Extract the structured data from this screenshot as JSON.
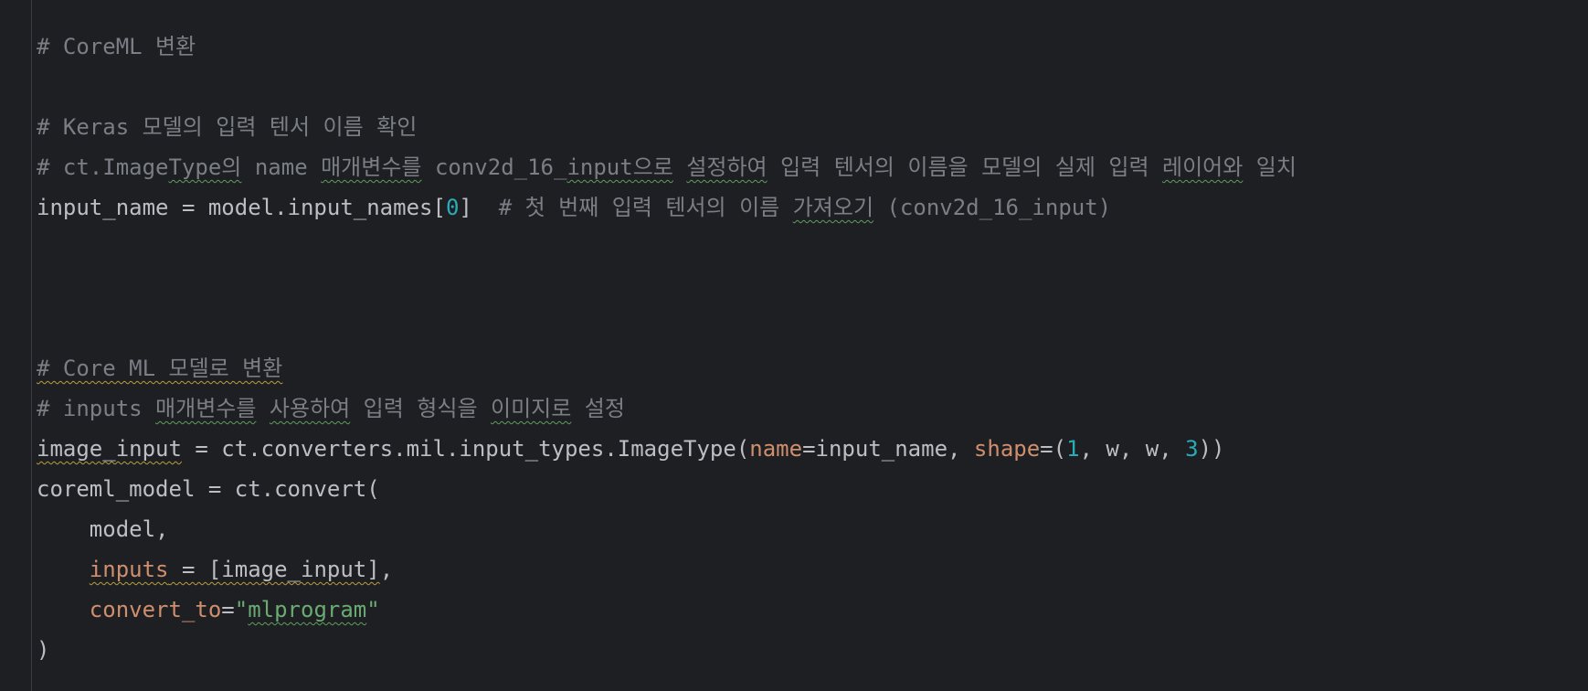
{
  "editor": {
    "lines": [
      [
        {
          "t": "# CoreML 변환",
          "c": "cm"
        }
      ],
      [],
      [
        {
          "t": "# Keras 모델의 입력 텐서 이름 확인",
          "c": "cm"
        }
      ],
      [
        {
          "t": "# ct.Image",
          "c": "cm"
        },
        {
          "t": "Type의",
          "c": "cm",
          "u": "g"
        },
        {
          "t": " name ",
          "c": "cm"
        },
        {
          "t": "매개변수를",
          "c": "cm",
          "u": "g"
        },
        {
          "t": " conv2d_16_",
          "c": "cm"
        },
        {
          "t": "input으로",
          "c": "cm",
          "u": "g"
        },
        {
          "t": " ",
          "c": "cm"
        },
        {
          "t": "설정하여",
          "c": "cm",
          "u": "g"
        },
        {
          "t": " 입력 텐서의 이름을 모델의 실제 입력 ",
          "c": "cm"
        },
        {
          "t": "레이어와",
          "c": "cm",
          "u": "g"
        },
        {
          "t": " 일치",
          "c": "cm"
        }
      ],
      [
        {
          "t": "input_name = model.input_names[",
          "c": "txt"
        },
        {
          "t": "0",
          "c": "num"
        },
        {
          "t": "]  ",
          "c": "txt"
        },
        {
          "t": "# 첫 번째 입력 텐서의 이름 ",
          "c": "cm"
        },
        {
          "t": "가져오기",
          "c": "cm",
          "u": "g"
        },
        {
          "t": " (conv2d_16_input)",
          "c": "cm"
        }
      ],
      [],
      [],
      [],
      [
        {
          "t": "# Core ML 모델로 변환",
          "c": "cm",
          "u": "y"
        }
      ],
      [
        {
          "t": "# inputs ",
          "c": "cm"
        },
        {
          "t": "매개변수를",
          "c": "cm",
          "u": "g"
        },
        {
          "t": " ",
          "c": "cm"
        },
        {
          "t": "사용하여",
          "c": "cm",
          "u": "g"
        },
        {
          "t": " 입력 형식을 ",
          "c": "cm"
        },
        {
          "t": "이미지로",
          "c": "cm",
          "u": "g"
        },
        {
          "t": " 설정",
          "c": "cm"
        }
      ],
      [
        {
          "t": "image_input",
          "c": "txt",
          "u": "y"
        },
        {
          "t": " = ct.converters.mil.input_types.ImageType(",
          "c": "txt"
        },
        {
          "t": "name",
          "c": "kw"
        },
        {
          "t": "=input_name, ",
          "c": "txt"
        },
        {
          "t": "shape",
          "c": "kw"
        },
        {
          "t": "=(",
          "c": "txt"
        },
        {
          "t": "1",
          "c": "num"
        },
        {
          "t": ", w, w, ",
          "c": "txt"
        },
        {
          "t": "3",
          "c": "num"
        },
        {
          "t": "))",
          "c": "txt"
        }
      ],
      [
        {
          "t": "coreml_model = ct.convert(",
          "c": "txt"
        }
      ],
      [
        {
          "t": "    model,",
          "c": "txt"
        }
      ],
      [
        {
          "t": "    ",
          "c": "txt"
        },
        {
          "t": "inputs",
          "c": "kw",
          "u": "y"
        },
        {
          "t": " = [image_input]",
          "c": "txt",
          "u": "y"
        },
        {
          "t": ",",
          "c": "txt"
        }
      ],
      [
        {
          "t": "    ",
          "c": "txt"
        },
        {
          "t": "convert_to",
          "c": "kw"
        },
        {
          "t": "=",
          "c": "txt"
        },
        {
          "t": "\"",
          "c": "str"
        },
        {
          "t": "mlprogram",
          "c": "str",
          "u": "g"
        },
        {
          "t": "\"",
          "c": "str"
        }
      ],
      [
        {
          "t": ")",
          "c": "txt"
        }
      ]
    ]
  }
}
